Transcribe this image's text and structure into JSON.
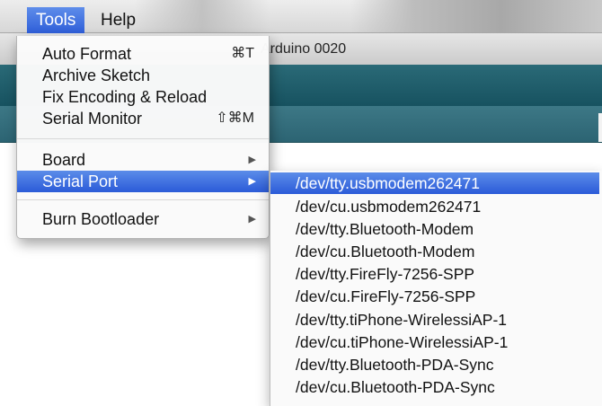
{
  "menubar": {
    "items": [
      {
        "label": "Tools",
        "active": true
      },
      {
        "label": "Help",
        "active": false
      }
    ]
  },
  "window": {
    "title": "Arduino 0020"
  },
  "tools_menu": {
    "items": [
      {
        "label": "Auto Format",
        "shortcut": "⌘T"
      },
      {
        "label": "Archive Sketch",
        "shortcut": ""
      },
      {
        "label": "Fix Encoding & Reload",
        "shortcut": ""
      },
      {
        "label": "Serial Monitor",
        "shortcut": "⇧⌘M"
      },
      {
        "label": "Board",
        "submenu": true
      },
      {
        "label": "Serial Port",
        "submenu": true,
        "highlighted": true
      },
      {
        "label": "Burn Bootloader",
        "submenu": true
      }
    ],
    "submenu_arrow": "▶"
  },
  "serial_port_menu": {
    "items": [
      {
        "label": "/dev/tty.usbmodem262471",
        "highlighted": true
      },
      {
        "label": "/dev/cu.usbmodem262471"
      },
      {
        "label": "/dev/tty.Bluetooth-Modem"
      },
      {
        "label": "/dev/cu.Bluetooth-Modem"
      },
      {
        "label": "/dev/tty.FireFly-7256-SPP"
      },
      {
        "label": "/dev/cu.FireFly-7256-SPP"
      },
      {
        "label": "/dev/tty.tiPhone-WirelessiAP-1"
      },
      {
        "label": "/dev/cu.tiPhone-WirelessiAP-1"
      },
      {
        "label": "/dev/tty.Bluetooth-PDA-Sync"
      },
      {
        "label": "/dev/cu.Bluetooth-PDA-Sync"
      }
    ]
  },
  "colors": {
    "highlight": "#2b5bd8",
    "toolbar": "#175260"
  }
}
